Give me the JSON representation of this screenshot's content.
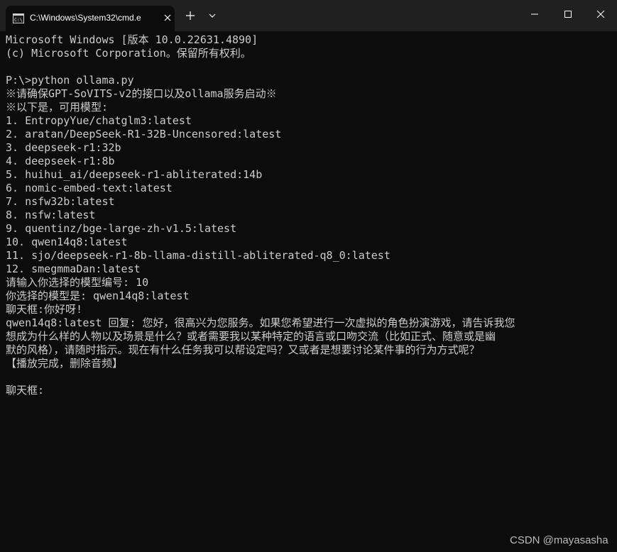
{
  "window": {
    "tab_title": "C:\\Windows\\System32\\cmd.e"
  },
  "colors": {
    "titlebar": "#202020",
    "console_bg": "#0c0c0c",
    "console_text": "#cccccc"
  },
  "icons": {
    "tab_icon": "cmd-icon",
    "tab_close": "close-icon",
    "new_tab": "plus-icon",
    "tab_menu": "chevron-down-icon",
    "minimize": "minimize-icon",
    "maximize": "maximize-icon",
    "close": "close-icon"
  },
  "console": {
    "lines": [
      "Microsoft Windows [版本 10.0.22631.4890]",
      "(c) Microsoft Corporation。保留所有权利。",
      "",
      "P:\\>python ollama.py",
      "※请确保GPT-SoVITS-v2的接口以及ollama服务启动※",
      "※以下是，可用模型:",
      "1. EntropyYue/chatglm3:latest",
      "2. aratan/DeepSeek-R1-32B-Uncensored:latest",
      "3. deepseek-r1:32b",
      "4. deepseek-r1:8b",
      "5. huihui_ai/deepseek-r1-abliterated:14b",
      "6. nomic-embed-text:latest",
      "7. nsfw32b:latest",
      "8. nsfw:latest",
      "9. quentinz/bge-large-zh-v1.5:latest",
      "10. qwen14q8:latest",
      "11. sjo/deepseek-r1-8b-llama-distill-abliterated-q8_0:latest",
      "12. smegmmaDan:latest",
      "请输入你选择的模型编号: 10",
      "你选择的模型是: qwen14q8:latest",
      "聊天框:你好呀!",
      "qwen14q8:latest 回复: 您好，很高兴为您服务。如果您希望进行一次虚拟的角色扮演游戏，请告诉我您",
      "想成为什么样的人物以及场景是什么？或者需要我以某种特定的语言或口吻交流（比如正式、随意或是幽",
      "默的风格），请随时指示。现在有什么任务我可以帮设定吗？又或者是想要讨论某件事的行为方式呢？",
      "【播放完成，删除音频】",
      "",
      "聊天框:"
    ]
  },
  "watermark": "CSDN @mayasasha"
}
